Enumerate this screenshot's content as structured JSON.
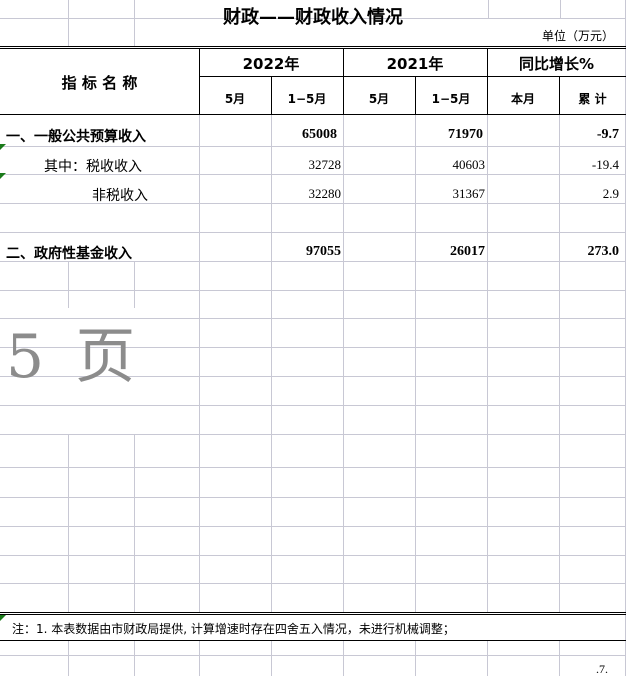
{
  "title": "财政——财政收入情况",
  "unit": "单位（万元）",
  "headers": {
    "indicator": "指 标 名 称",
    "year_2022": "2022年",
    "year_2021": "2021年",
    "yoy": "同比增长%",
    "month": "5月",
    "ytd": "1−5月",
    "this_month": "本月",
    "cumulative": "累  计"
  },
  "rows": [
    {
      "label": "一、一般公共预算收入",
      "ytd_2022": "65008",
      "ytd_2021": "71970",
      "cumulative": "-9.7"
    },
    {
      "label": "其中：税收收入",
      "ytd_2022": "32728",
      "ytd_2021": "40603",
      "cumulative": "-19.4"
    },
    {
      "label": "非税收入",
      "ytd_2022": "32280",
      "ytd_2021": "31367",
      "cumulative": "2.9"
    },
    {
      "label": "二、政府性基金收入",
      "ytd_2022": "97055",
      "ytd_2021": "26017",
      "cumulative": "273.0"
    }
  ],
  "watermark": "5 页",
  "note": "注：1. 本表数据由市财政局提供, 计算增速时存在四舍五入情况，未进行机械调整；",
  "page_number": ".7."
}
